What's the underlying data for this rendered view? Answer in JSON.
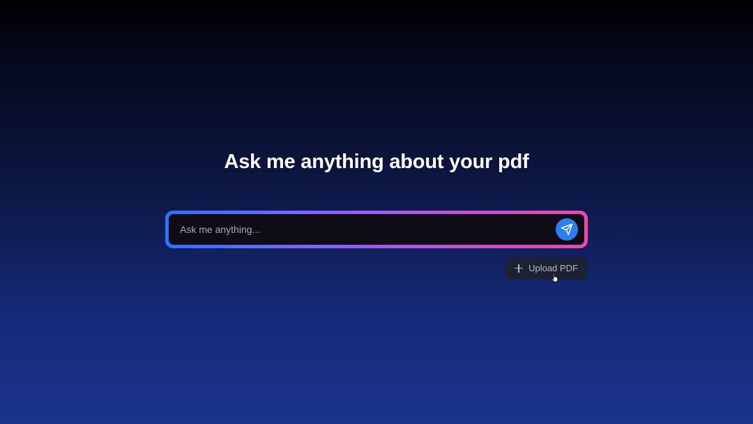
{
  "main": {
    "title": "Ask me anything about your pdf"
  },
  "chat": {
    "input_placeholder": "Ask me anything...",
    "input_value": "",
    "send_icon": "send-icon"
  },
  "upload": {
    "label": "Upload PDF",
    "icon": "plus-icon"
  },
  "colors": {
    "accent_blue": "#2a7df2",
    "gradient_start": "#2b73ff",
    "gradient_mid": "#b653e6",
    "gradient_end": "#e84aa7",
    "background_top": "#000000",
    "background_bottom": "#1b338b"
  }
}
